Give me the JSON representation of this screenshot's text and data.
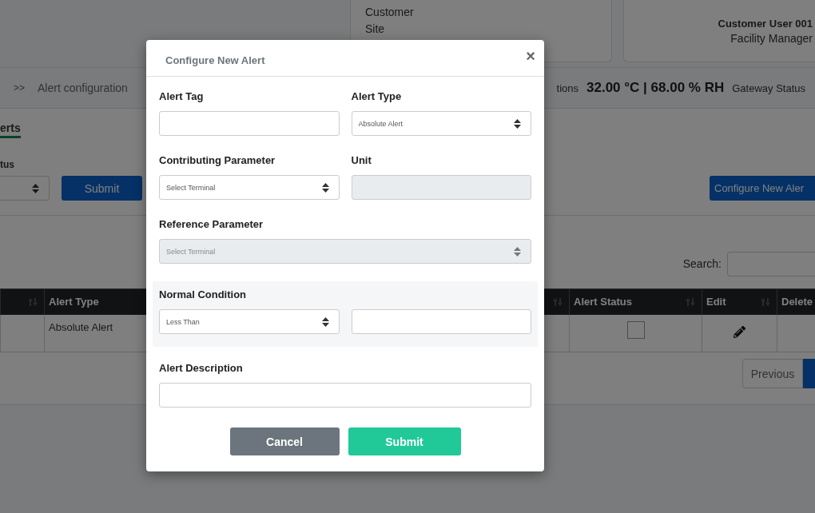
{
  "header": {
    "site_card": [
      "Customer",
      "Site"
    ],
    "user": {
      "name": "Customer User 001",
      "role": "Facility Manager"
    }
  },
  "breadcrumb": {
    "separator": ">>",
    "current": "Alert configuration"
  },
  "status": {
    "label": "tions",
    "reading": "32.00 °C | 68.00 % RH",
    "gateway_label": "Gateway Status"
  },
  "tabs": [
    {
      "label": "erts",
      "selected": true
    }
  ],
  "filter": {
    "label": "tus",
    "submit": "Submit",
    "configure": "Configure New Aler"
  },
  "search": {
    "label": "Search:"
  },
  "table": {
    "columns": [
      {},
      {
        "label": "Alert Type"
      },
      {},
      {
        "label": "Alert Status"
      },
      {
        "label": "Edit"
      },
      {
        "label": "Delete"
      }
    ],
    "rows": [
      {
        "alert_type": "Absolute Alert",
        "status_checked": false
      }
    ]
  },
  "pagination": {
    "previous": "Previous"
  },
  "modal": {
    "title": "Configure New Alert",
    "close": "×",
    "rows": [
      {
        "highlighted": false,
        "fields": [
          {
            "label": "Alert Tag",
            "kind": "input",
            "disabled": false
          },
          {
            "label": "Alert Type",
            "kind": "select",
            "value": "Absolute Alert",
            "disabled": false
          }
        ]
      },
      {
        "highlighted": false,
        "fields": [
          {
            "label": "Contributing Parameter",
            "kind": "select",
            "value": "Select Terminal",
            "disabled": false
          },
          {
            "label": "Unit",
            "kind": "input",
            "disabled": true
          }
        ]
      },
      {
        "highlighted": false,
        "fields": [
          {
            "label": "Reference Parameter",
            "kind": "select",
            "value": "Select Terminal",
            "disabled": true
          }
        ]
      },
      {
        "highlighted": true,
        "label": "Normal Condition",
        "fields": [
          {
            "kind": "select",
            "value": "Less Than",
            "disabled": false
          },
          {
            "kind": "input",
            "disabled": false
          }
        ]
      },
      {
        "highlighted": false,
        "fields": [
          {
            "label": "Alert Description",
            "kind": "input",
            "disabled": false
          }
        ]
      }
    ],
    "buttons": [
      {
        "label": "Cancel",
        "kind": "secondary"
      },
      {
        "label": "Submit",
        "kind": "primary"
      }
    ]
  }
}
